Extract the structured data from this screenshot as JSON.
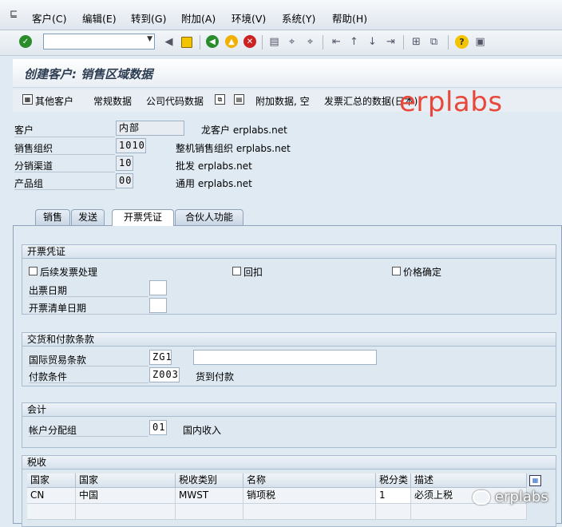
{
  "menu": {
    "items": [
      "客户(C)",
      "编辑(E)",
      "转到(G)",
      "附加(A)",
      "环境(V)",
      "系统(Y)",
      "帮助(H)"
    ]
  },
  "toolbar": {
    "command_value": "",
    "icons": [
      "enter-icon",
      "save-icon",
      "back-icon",
      "exit-icon",
      "cancel-icon",
      "print-icon",
      "find-icon",
      "find-next-icon",
      "first-page-icon",
      "prev-page-icon",
      "next-page-icon",
      "last-page-icon",
      "create-session-icon",
      "shortcut-icon",
      "help-icon",
      "layout-icon"
    ]
  },
  "title": "创建客户: 销售区域数据",
  "app_toolbar": {
    "other_customer": "其他客户",
    "general_data": "常规数据",
    "company_code_data": "公司代码数据",
    "additional_data_empty": "附加数据, 空",
    "billing_summary": "发票汇总的数据(日本)"
  },
  "watermark": "erplabs",
  "watermark_wechat": "erplabs",
  "header": {
    "customer_label": "客户",
    "customer_value": "内部",
    "customer_desc": "龙客户 erplabs.net",
    "sales_org_label": "销售组织",
    "sales_org_value": "1010",
    "sales_org_desc": "整机销售组织 erplabs.net",
    "dist_channel_label": "分销渠道",
    "dist_channel_value": "10",
    "dist_channel_desc": "批发 erplabs.net",
    "division_label": "产品组",
    "division_value": "00",
    "division_desc": "通用 erplabs.net"
  },
  "tabs": [
    "销售",
    "发送",
    "开票凭证",
    "合伙人功能"
  ],
  "active_tab": "开票凭证",
  "billing": {
    "title": "开票凭证",
    "subsequent_invoice": "后续发票处理",
    "rebate": "回扣",
    "price_determination": "价格确定",
    "invoice_dates": "出票日期",
    "invoice_list_dates": "开票清单日期"
  },
  "delivery": {
    "title": "交货和付款条款",
    "incoterms_label": "国际贸易条款",
    "incoterms_value": "ZG1",
    "incoterms2_value": "",
    "payment_terms_label": "付款条件",
    "payment_terms_value": "Z003",
    "payment_terms_desc": "货到付款"
  },
  "accounting": {
    "title": "会计",
    "acct_group_label": "帐户分配组",
    "acct_group_value": "01",
    "acct_group_desc": "国内收入"
  },
  "taxes": {
    "title": "税收",
    "columns": [
      "国家",
      "国家",
      "税收类别",
      "名称",
      "税分类",
      "描述"
    ],
    "rows": [
      [
        "CN",
        "中国",
        "MWST",
        "销项税",
        "1",
        "必须上税"
      ]
    ]
  }
}
